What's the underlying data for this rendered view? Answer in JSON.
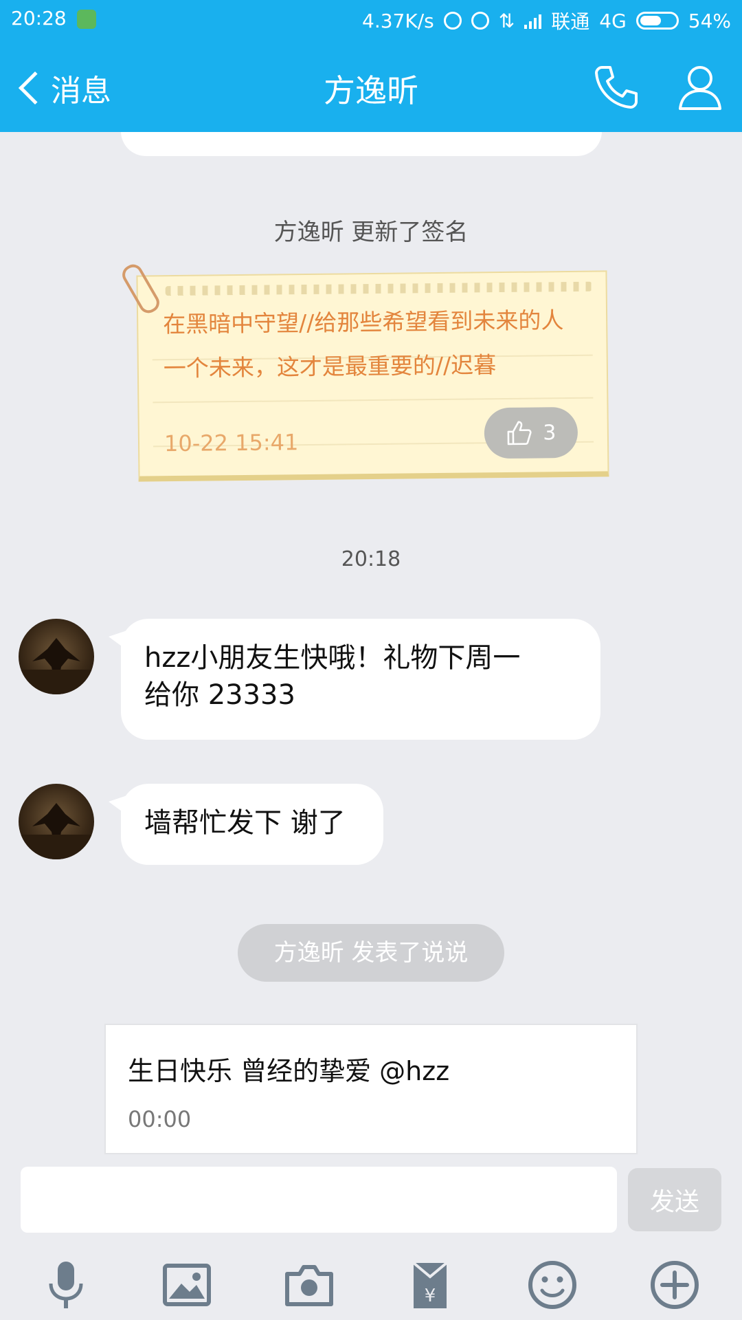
{
  "status_bar": {
    "time": "20:28",
    "net_speed": "4.37K/s",
    "carrier": "联通",
    "network": "4G",
    "battery": "54%",
    "icons": [
      "shield-icon",
      "mute-bell-icon",
      "alarm-icon",
      "data-arrows-icon",
      "signal-icon",
      "battery-icon"
    ]
  },
  "header": {
    "back_label": "消息",
    "title": "方逸昕",
    "accent_color": "#19b0ee",
    "icons": [
      "back-chevron-icon",
      "phone-icon",
      "contact-icon"
    ]
  },
  "chat": {
    "signature_update": "方逸昕 更新了签名",
    "signature_card": {
      "text": "在黑暗中守望//给那些希望看到未来的人一个未来，这才是最重要的//迟暮",
      "date": "10-22 15:41",
      "likes": "3"
    },
    "timestamp": "20:18",
    "messages": [
      {
        "sender": "方逸昕",
        "text_line1": "hzz小朋友生快哦！礼物下周一",
        "text_line2": "给你 23333"
      },
      {
        "sender": "方逸昕",
        "text": "墙帮忙发下 谢了"
      }
    ],
    "post_notice": "方逸昕 发表了说说",
    "post_card": {
      "text": "生日快乐 曾经的挚爱 @hzz",
      "time": "00:00"
    }
  },
  "input": {
    "value": "",
    "send_label": "发送"
  },
  "toolbar": {
    "icons": [
      "microphone-icon",
      "image-icon",
      "camera-icon",
      "red-packet-icon",
      "emoji-icon",
      "plus-icon"
    ]
  }
}
